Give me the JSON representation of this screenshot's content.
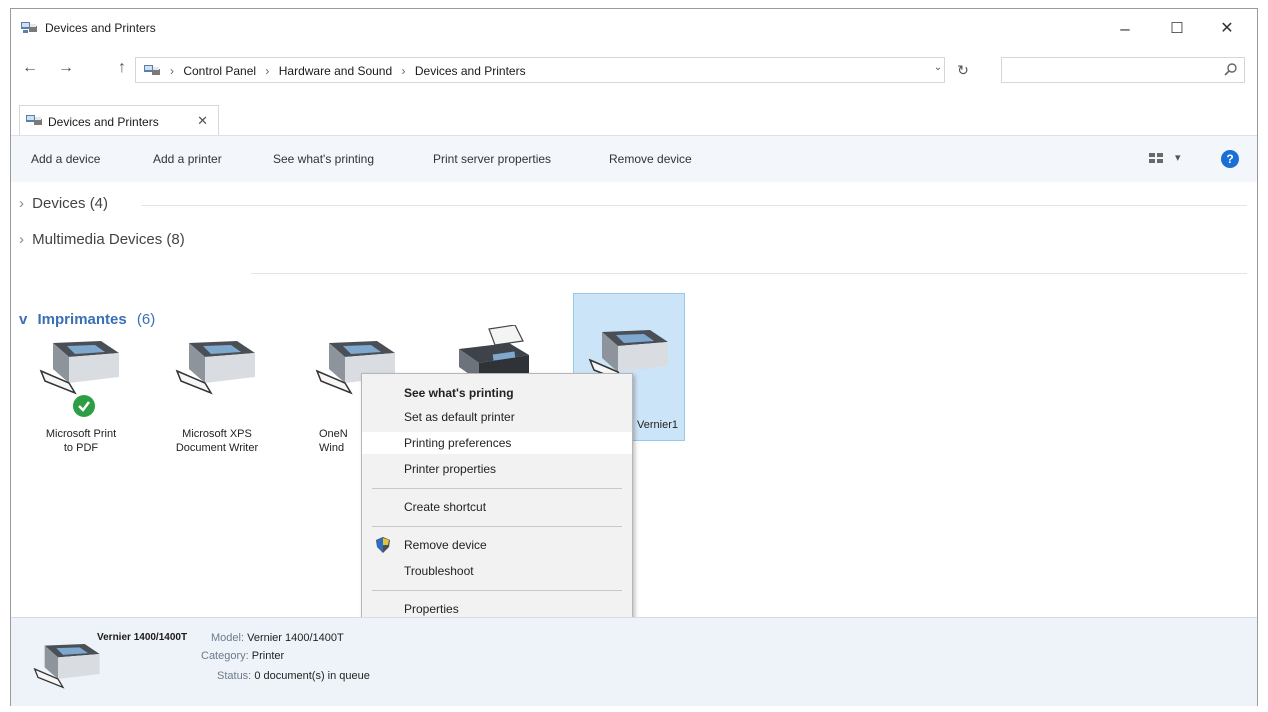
{
  "window": {
    "title": "Devices and Printers",
    "minimize": "–",
    "maximize": "☐",
    "close": "✕"
  },
  "address": {
    "back": "←",
    "forward": "→",
    "up": "↑",
    "crumbs": [
      "Control Panel",
      "Hardware and Sound",
      "Devices and Printers"
    ],
    "separator": "›",
    "dropdown": "⌄",
    "refresh": "↻"
  },
  "search": {
    "placeholder": ""
  },
  "tab": {
    "label": "Devices and Printers",
    "close": "✕"
  },
  "commands": [
    "Add a device",
    "Add a printer",
    "See what's printing",
    "Print server properties",
    "Remove device"
  ],
  "view": {
    "label": "▾"
  },
  "help": {
    "label": "?"
  },
  "groups": {
    "devices": {
      "chevron": "›",
      "label": "Devices (4)"
    },
    "multimedia": {
      "chevron": "›",
      "label": "Multimedia Devices (8)"
    },
    "printers": {
      "chevron": "v",
      "label": "Imprimantes",
      "count": "(6)"
    }
  },
  "printers": [
    {
      "line1": "Microsoft Print",
      "line2": "to PDF",
      "default": true
    },
    {
      "line1": "Microsoft XPS",
      "line2": "Document Writer",
      "default": false
    },
    {
      "line1": "OneN",
      "line2": "Wind",
      "default": false
    },
    {
      "line1": "",
      "line2": "",
      "default": false
    },
    {
      "line1": "Vernier1",
      "line2": "",
      "default": false
    }
  ],
  "context_menu": {
    "items": [
      {
        "label": "See what's printing",
        "bold": true
      },
      {
        "label": "Set as default printer"
      },
      {
        "label": "Printing preferences",
        "highlight": true
      },
      {
        "label": "Printer properties"
      },
      {
        "label": "Create shortcut"
      },
      {
        "label": "Remove device"
      },
      {
        "label": "Troubleshoot"
      },
      {
        "label": "Properties"
      }
    ]
  },
  "details": {
    "name": "Vernier 1400/1400T",
    "model_label": "Model:",
    "model_value": "Vernier 1400/1400T",
    "category_label": "Category:",
    "category_value": "Printer",
    "status_label": "Status:",
    "status_value": "0 document(s) in queue"
  },
  "colors": {
    "accent": "#1a6fd6",
    "selection": "#cce4f7",
    "group_blue": "#3a6fb5",
    "default_check": "#2e9e44"
  }
}
